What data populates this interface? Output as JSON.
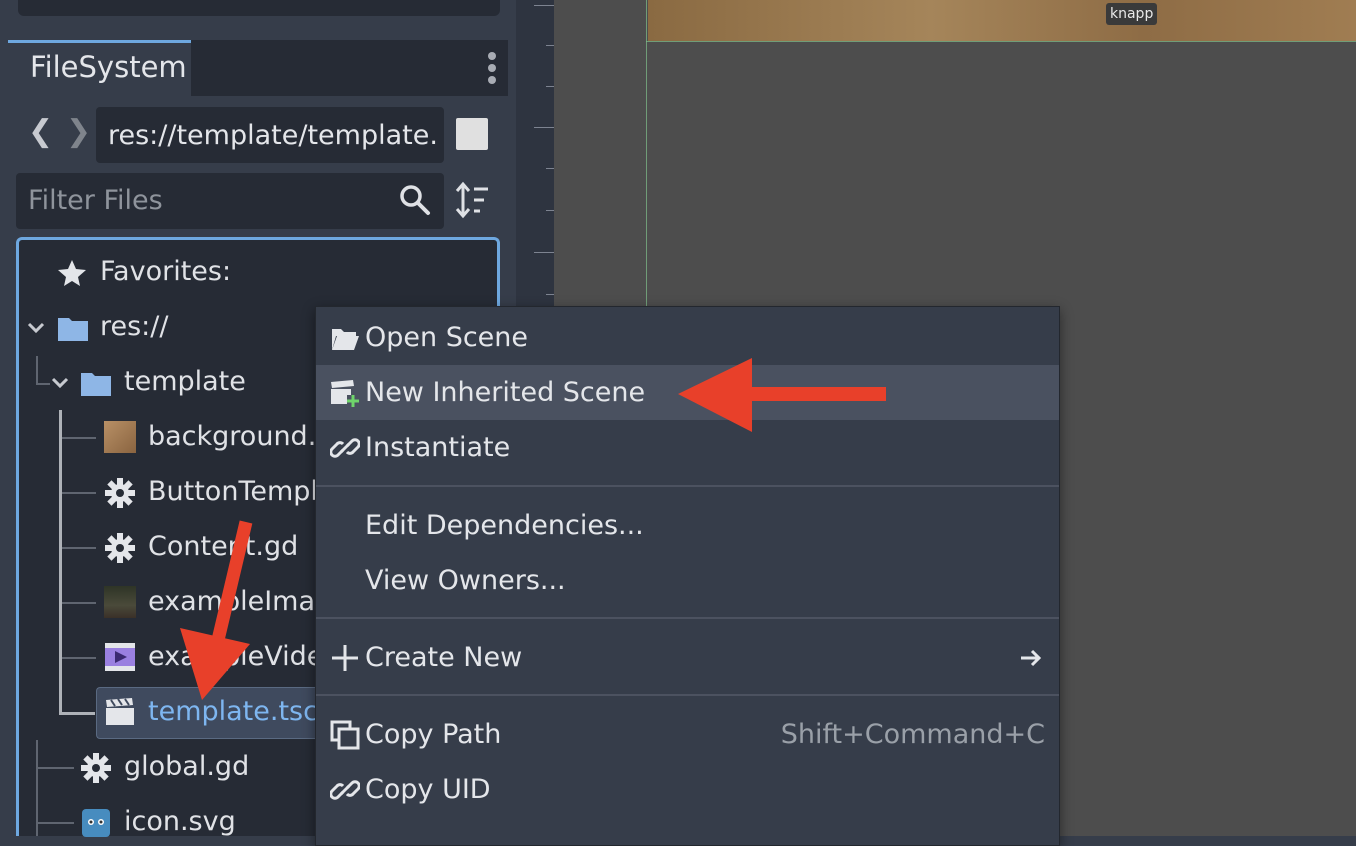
{
  "filesystem": {
    "tab_label": "FileSystem",
    "path": "res://template/template.",
    "filter_placeholder": "Filter Files",
    "favorites_label": "Favorites:",
    "tree": [
      {
        "name": "res://"
      },
      {
        "name": "template"
      },
      {
        "name": "background."
      },
      {
        "name": "ButtonTempl"
      },
      {
        "name": "Content.gd"
      },
      {
        "name": "exampleImag"
      },
      {
        "name": "exampleVide"
      },
      {
        "name": "template.tscn"
      },
      {
        "name": "global.gd"
      },
      {
        "name": "icon.svg"
      }
    ]
  },
  "viewport": {
    "node_label": "knapp"
  },
  "context_menu": {
    "items": [
      {
        "label": "Open Scene"
      },
      {
        "label": "New Inherited Scene"
      },
      {
        "label": "Instantiate"
      },
      {
        "label": "Edit Dependencies..."
      },
      {
        "label": "View Owners..."
      },
      {
        "label": "Create New"
      },
      {
        "label": "Copy Path",
        "shortcut": "Shift+Command+C"
      },
      {
        "label": "Copy UID"
      }
    ]
  },
  "colors": {
    "accent": "#6ea8e0",
    "annotation_arrow": "#e8402a",
    "selected_text": "#7eb6f0"
  }
}
